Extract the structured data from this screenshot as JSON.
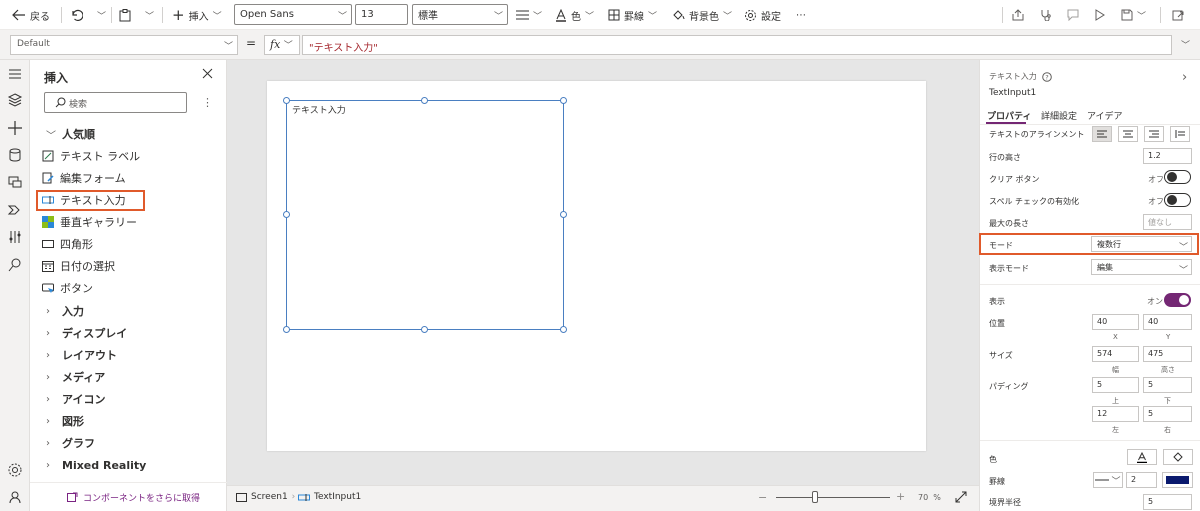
{
  "toolbar": {
    "back_label": "戻る",
    "insert_label": "挿入",
    "font_name": "Open Sans",
    "font_size": "13",
    "font_weight": "標準",
    "color_label": "色",
    "border_label": "罫線",
    "fill_label": "背景色",
    "settings_label": "設定",
    "more_label": "⋯"
  },
  "formula_bar": {
    "property": "Default",
    "equals": "=",
    "fx": "fx",
    "formula": "\"テキスト入力\""
  },
  "insert_pane": {
    "title": "挿入",
    "search_placeholder": "検索",
    "popular_label": "人気順",
    "items": [
      {
        "label": "テキスト ラベル",
        "icon": "label-icon"
      },
      {
        "label": "編集フォーム",
        "icon": "edit-form-icon"
      },
      {
        "label": "テキスト入力",
        "icon": "text-input-icon"
      },
      {
        "label": "垂直ギャラリー",
        "icon": "gallery-icon"
      },
      {
        "label": "四角形",
        "icon": "rectangle-icon"
      },
      {
        "label": "日付の選択",
        "icon": "date-picker-icon"
      },
      {
        "label": "ボタン",
        "icon": "button-icon"
      }
    ],
    "groups": [
      "入力",
      "ディスプレイ",
      "レイアウト",
      "メディア",
      "アイコン",
      "図形",
      "グラフ",
      "Mixed Reality"
    ],
    "more_components": "コンポーネントをさらに取得"
  },
  "canvas": {
    "control_text": "テキスト入力"
  },
  "status_bar": {
    "screen_name": "Screen1",
    "control_name": "TextInput1",
    "zoom_minus": "−",
    "zoom_plus": "+",
    "zoom_value": "70",
    "zoom_unit": "%",
    "zoom_level": 0.34
  },
  "props": {
    "type_label": "テキスト入力",
    "control_name": "TextInput1",
    "tabs": [
      "プロパティ",
      "詳細設定",
      "アイデア"
    ],
    "align_label": "テキストのアラインメント",
    "line_height_label": "行の高さ",
    "line_height_value": "1.2",
    "clear_button_label": "クリア ボタン",
    "clear_button_state": "オフ",
    "spellcheck_label": "スペル チェックの有効化",
    "spellcheck_state": "オフ",
    "max_length_label": "最大の長さ",
    "max_length_placeholder": "値なし",
    "mode_label": "モード",
    "mode_value": "複数行",
    "display_mode_label": "表示モード",
    "display_mode_value": "編集",
    "visible_label": "表示",
    "visible_state": "オン",
    "position_label": "位置",
    "pos_x": "40",
    "pos_y": "40",
    "pos_x_caption": "X",
    "pos_y_caption": "Y",
    "size_label": "サイズ",
    "width": "574",
    "height": "475",
    "width_caption": "幅",
    "height_caption": "高さ",
    "padding_label": "パディング",
    "pad_top": "5",
    "pad_bottom": "5",
    "pad_left": "12",
    "pad_right": "5",
    "pad_top_caption": "上",
    "pad_bottom_caption": "下",
    "pad_left_caption": "左",
    "pad_right_caption": "右",
    "color_label": "色",
    "border_label": "罫線",
    "border_width": "2",
    "border_color": "#0a1a6e",
    "radius_label": "境界半径",
    "radius_value": "5"
  },
  "colors": {
    "accent": "#742774",
    "highlight": "#e05a2b",
    "selection": "#4a7fc1"
  }
}
